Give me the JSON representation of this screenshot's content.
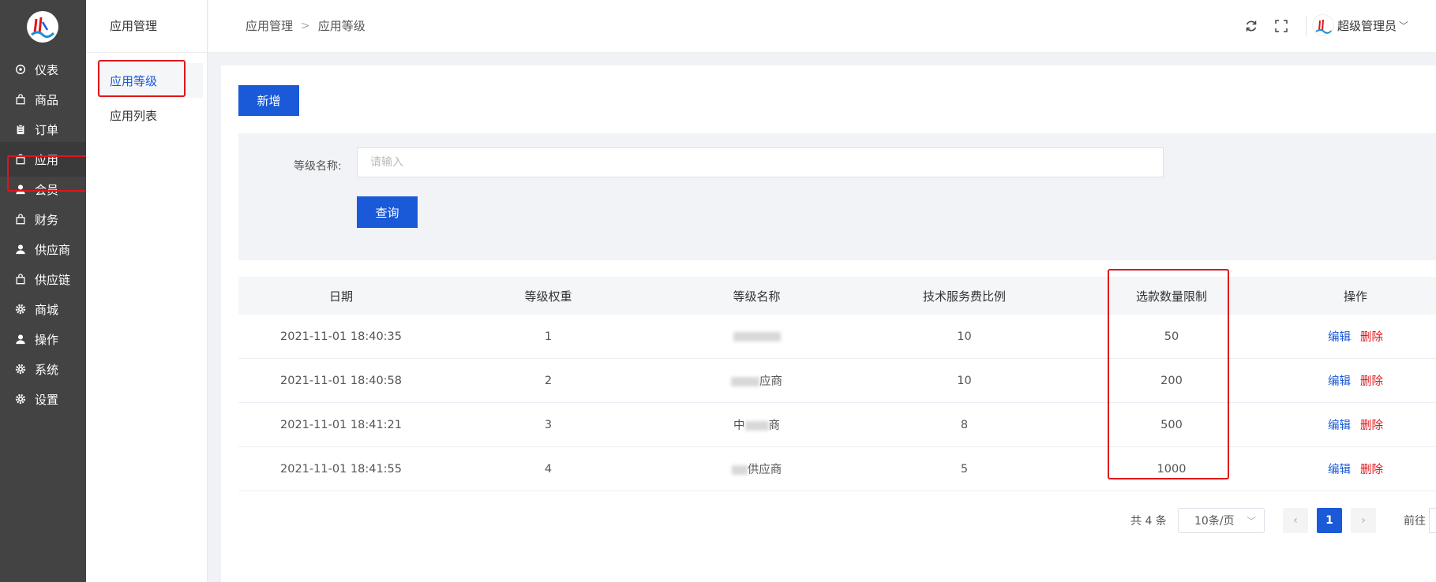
{
  "sidebar": {
    "logo": "logo-icon",
    "items": [
      {
        "label": "仪表",
        "icon": "dashboard-icon"
      },
      {
        "label": "商品",
        "icon": "bag-icon"
      },
      {
        "label": "订单",
        "icon": "clipboard-icon"
      },
      {
        "label": "应用",
        "icon": "bag-icon"
      },
      {
        "label": "会员",
        "icon": "user-icon"
      },
      {
        "label": "财务",
        "icon": "bag-icon"
      },
      {
        "label": "供应商",
        "icon": "user-icon"
      },
      {
        "label": "供应链",
        "icon": "bag-icon"
      },
      {
        "label": "商城",
        "icon": "gear-icon"
      },
      {
        "label": "操作",
        "icon": "user-icon"
      },
      {
        "label": "系统",
        "icon": "gear-icon"
      },
      {
        "label": "设置",
        "icon": "gear-icon"
      }
    ],
    "active_index": 3
  },
  "subsidebar": {
    "title": "应用管理",
    "items": [
      {
        "label": "应用等级"
      },
      {
        "label": "应用列表"
      }
    ],
    "active_index": 0
  },
  "header": {
    "breadcrumb": [
      "应用管理",
      "应用等级"
    ],
    "separator": ">",
    "icons": [
      "refresh-icon",
      "fullscreen-icon"
    ],
    "user_name": "超级管理员"
  },
  "toolbar": {
    "add_label": "新增"
  },
  "search": {
    "label": "等级名称:",
    "placeholder": "请输入",
    "value": "",
    "query_label": "查询"
  },
  "table": {
    "columns": [
      "日期",
      "等级权重",
      "等级名称",
      "技术服务费比例",
      "选款数量限制",
      "操作"
    ],
    "rows": [
      {
        "date": "2021-11-01 18:40:35",
        "weight": "1",
        "name": "",
        "fee": "10",
        "limit": "50"
      },
      {
        "date": "2021-11-01 18:40:58",
        "weight": "2",
        "name": "应商",
        "fee": "10",
        "limit": "200"
      },
      {
        "date": "2021-11-01 18:41:21",
        "weight": "3",
        "name": "中",
        "name_suffix": "商",
        "fee": "8",
        "limit": "500"
      },
      {
        "date": "2021-11-01 18:41:55",
        "weight": "4",
        "name": "供应商",
        "fee": "5",
        "limit": "1000"
      }
    ],
    "edit_label": "编辑",
    "delete_label": "删除"
  },
  "pagination": {
    "total": "共 4 条",
    "page_size": "10条/页",
    "current_page": "1",
    "prev": "‹",
    "next": "›",
    "goto_label": "前往"
  },
  "colors": {
    "primary": "#1a5ad8",
    "danger": "#e0151b",
    "sidebar_bg": "#434343"
  }
}
